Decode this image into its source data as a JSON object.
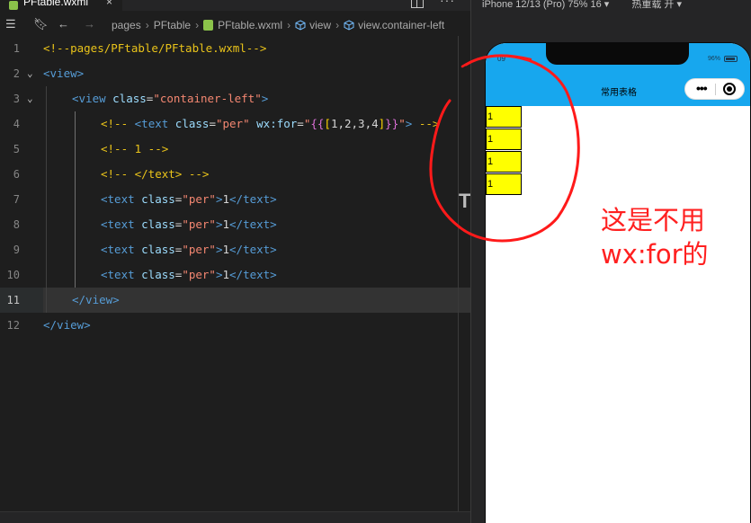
{
  "editor": {
    "tab_label": "PFtable.wxml",
    "tab_close": "×",
    "more_label": "···",
    "breadcrumbs": [
      "pages",
      "PFtable",
      "PFtable.wxml",
      "view",
      "view.container-left"
    ],
    "lines": [
      {
        "n": "1",
        "indent": 0,
        "tokens": [
          {
            "c": "c-comment",
            "t": "<!--pages/PFtable/PFtable.wxml-->"
          }
        ]
      },
      {
        "n": "2",
        "indent": 0,
        "fold": "v",
        "tokens": [
          {
            "c": "c-tag",
            "t": "<view>"
          }
        ]
      },
      {
        "n": "3",
        "indent": 1,
        "fold": "v",
        "tokens": [
          {
            "c": "c-tag",
            "t": "<view "
          },
          {
            "c": "c-attr",
            "t": "class"
          },
          {
            "c": "c-text",
            "t": "="
          },
          {
            "c": "c-str",
            "t": "\"container-left\""
          },
          {
            "c": "c-tag",
            "t": ">"
          }
        ]
      },
      {
        "n": "4",
        "indent": 2,
        "tokens": [
          {
            "c": "c-comment",
            "t": "<!-- "
          },
          {
            "c": "c-tag",
            "t": "<text "
          },
          {
            "c": "c-attr",
            "t": "class"
          },
          {
            "c": "c-text",
            "t": "="
          },
          {
            "c": "c-str",
            "t": "\"per\""
          },
          {
            "c": "c-text",
            "t": " "
          },
          {
            "c": "c-attr",
            "t": "wx:for"
          },
          {
            "c": "c-text",
            "t": "="
          },
          {
            "c": "c-str",
            "t": "\""
          },
          {
            "c": "c-brace1",
            "t": "{{"
          },
          {
            "c": "c-brace2",
            "t": "["
          },
          {
            "c": "c-text",
            "t": "1,2,3,4"
          },
          {
            "c": "c-brace2",
            "t": "]"
          },
          {
            "c": "c-brace1",
            "t": "}}"
          },
          {
            "c": "c-str",
            "t": "\""
          },
          {
            "c": "c-tag",
            "t": ">"
          },
          {
            "c": "c-comment",
            "t": " -->"
          }
        ]
      },
      {
        "n": "5",
        "indent": 2,
        "tokens": [
          {
            "c": "c-comment",
            "t": "<!-- 1 -->"
          }
        ]
      },
      {
        "n": "6",
        "indent": 2,
        "tokens": [
          {
            "c": "c-comment",
            "t": "<!-- </text> -->"
          }
        ]
      },
      {
        "n": "7",
        "indent": 2,
        "tokens": [
          {
            "c": "c-tag",
            "t": "<text "
          },
          {
            "c": "c-attr",
            "t": "class"
          },
          {
            "c": "c-text",
            "t": "="
          },
          {
            "c": "c-str",
            "t": "\"per\""
          },
          {
            "c": "c-tag",
            "t": ">"
          },
          {
            "c": "c-text",
            "t": "1"
          },
          {
            "c": "c-tag",
            "t": "</text>"
          }
        ]
      },
      {
        "n": "8",
        "indent": 2,
        "tokens": [
          {
            "c": "c-tag",
            "t": "<text "
          },
          {
            "c": "c-attr",
            "t": "class"
          },
          {
            "c": "c-text",
            "t": "="
          },
          {
            "c": "c-str",
            "t": "\"per\""
          },
          {
            "c": "c-tag",
            "t": ">"
          },
          {
            "c": "c-text",
            "t": "1"
          },
          {
            "c": "c-tag",
            "t": "</text>"
          }
        ]
      },
      {
        "n": "9",
        "indent": 2,
        "tokens": [
          {
            "c": "c-tag",
            "t": "<text "
          },
          {
            "c": "c-attr",
            "t": "class"
          },
          {
            "c": "c-text",
            "t": "="
          },
          {
            "c": "c-str",
            "t": "\"per\""
          },
          {
            "c": "c-tag",
            "t": ">"
          },
          {
            "c": "c-text",
            "t": "1"
          },
          {
            "c": "c-tag",
            "t": "</text>"
          }
        ]
      },
      {
        "n": "10",
        "indent": 2,
        "tokens": [
          {
            "c": "c-tag",
            "t": "<text "
          },
          {
            "c": "c-attr",
            "t": "class"
          },
          {
            "c": "c-text",
            "t": "="
          },
          {
            "c": "c-str",
            "t": "\"per\""
          },
          {
            "c": "c-tag",
            "t": ">"
          },
          {
            "c": "c-text",
            "t": "1"
          },
          {
            "c": "c-tag",
            "t": "</text>"
          }
        ]
      },
      {
        "n": "11",
        "indent": 1,
        "current": true,
        "tokens": [
          {
            "c": "c-tag",
            "t": "</view>"
          }
        ]
      },
      {
        "n": "12",
        "indent": 0,
        "tokens": [
          {
            "c": "c-tag",
            "t": "</view>"
          }
        ]
      }
    ],
    "cursor_glyph": "T"
  },
  "simulator": {
    "device_label": "iPhone 12/13 (Pro) 75% 16 ▾",
    "hot_reload_label": "热重载 开 ▾",
    "status_time": "09",
    "status_battery": "96%",
    "page_title": "常用表格",
    "capsule_dots": "•••",
    "per_items": [
      "1",
      "1",
      "1",
      "1"
    ]
  },
  "annotation": {
    "line1": "这是不用",
    "line2": "wx:for的"
  },
  "colors": {
    "nav_bar": "#17a7ee",
    "per_bg": "#ffff00",
    "annotation": "#ff2020"
  },
  "icons": [
    "explorer-icon",
    "bookmark-icon",
    "back-arrow-icon",
    "forward-arrow-icon",
    "file-icon",
    "cube-icon",
    "split-editor-icon",
    "more-icon",
    "battery-icon",
    "close-target-icon"
  ]
}
